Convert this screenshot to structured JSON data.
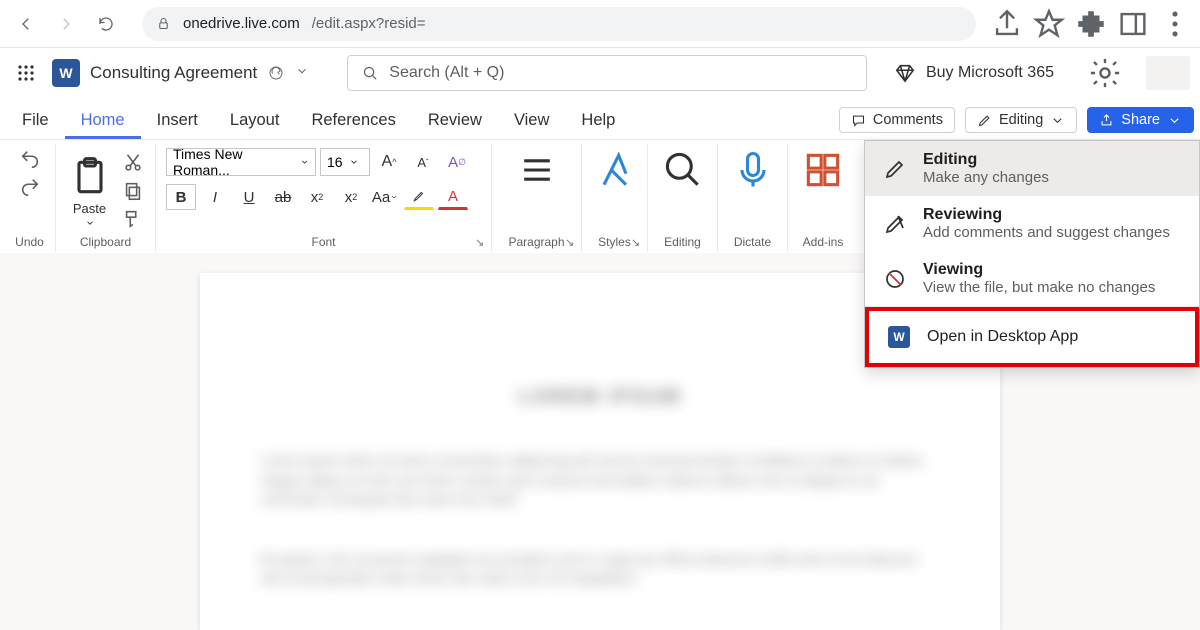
{
  "browser": {
    "url_host": "onedrive.live.com",
    "url_path": "/edit.aspx?resid="
  },
  "header": {
    "doc_title": "Consulting Agreement",
    "search_placeholder": "Search (Alt + Q)",
    "buy_label": "Buy Microsoft 365"
  },
  "tabs": {
    "file": "File",
    "home": "Home",
    "insert": "Insert",
    "layout": "Layout",
    "references": "References",
    "review": "Review",
    "view": "View",
    "help": "Help"
  },
  "actions": {
    "comments": "Comments",
    "editing": "Editing",
    "share": "Share"
  },
  "ribbon": {
    "undo": "Undo",
    "paste": "Paste",
    "clipboard": "Clipboard",
    "font_name": "Times New Roman...",
    "font_size": "16",
    "font": "Font",
    "paragraph": "Paragraph",
    "styles": "Styles",
    "editing": "Editing",
    "dictate": "Dictate",
    "addins": "Add-ins"
  },
  "dropdown": {
    "editing_title": "Editing",
    "editing_sub": "Make any changes",
    "reviewing_title": "Reviewing",
    "reviewing_sub": "Add comments and suggest changes",
    "viewing_title": "Viewing",
    "viewing_sub": "View the file, but make no changes",
    "open_desktop": "Open in Desktop App"
  }
}
